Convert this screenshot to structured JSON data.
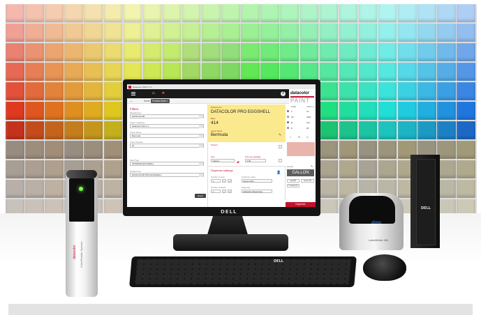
{
  "window": {
    "title": "Datacolor PAINT 1.0"
  },
  "app": {
    "logo_brand": "datacolor",
    "logo_product": "PAINT",
    "help_label": "?",
    "breadcrumb": {
      "home": "Home",
      "current_tab": "Formula Book",
      "tab_close": "×"
    }
  },
  "filters": {
    "title": "Filters",
    "items": [
      {
        "label": "Manufacturer",
        "value": "DATACOLOR"
      },
      {
        "label": "Colour Collection",
        "value": "Datacolor Demo 1"
      },
      {
        "label": "Colour Name",
        "value": "Bermuda"
      },
      {
        "label": "Colour Number",
        "value": "ID"
      },
      {
        "label": "Paint Type",
        "value": "INTERIOR EGGSHELL"
      },
      {
        "label": "Product Line",
        "value": "DATACOLOR PRO EGGSHELL"
      }
    ],
    "reset_label": "Reset"
  },
  "product": {
    "product_line_label": "Product Line",
    "product_line_value": "DATACOLOR PRO EGGSHELL",
    "base_label": "Base",
    "base_value": "414",
    "colour_name_label": "Colour Name",
    "colour_name_value": "Bermuda",
    "product_label": "Product",
    "size_label": "Size",
    "size_value": "Gallons",
    "price_label": "Price per package",
    "price_value": "0.00",
    "package_icon": "paint-can-icon"
  },
  "dispense": {
    "title": "Dispense settings",
    "number_of_cans_label": "Number of cans",
    "number_of_cans_value": "1",
    "customer_label": "Customer name",
    "customer_value": "james smith",
    "number_of_labels_label": "Number of labels",
    "number_of_labels_value": "1",
    "dispenser_label": "Dispenser",
    "dispenser_value": "datacolor [dispensing]"
  },
  "formula": {
    "col_name": "NAME",
    "col_amount": "1/384 fl oz",
    "rows": [
      {
        "name": "F",
        "amount": "76",
        "color": "#8a2a1e"
      },
      {
        "name": "KX",
        "amount": "4100",
        "color": "#ffffff"
      },
      {
        "name": "B",
        "amount": "124",
        "color": "#111111"
      },
      {
        "name": "D",
        "amount": "28",
        "color": "#f2b418"
      }
    ],
    "tool_icons": [
      "✓",
      "%",
      "⎙"
    ],
    "preview_color": "#e9b4ac"
  },
  "format": {
    "label": "Format",
    "selected": "GALLON",
    "options": [
      "QUART",
      "GALLON",
      "5 GALLON"
    ]
  },
  "actions": {
    "dispense_label": "Dispense"
  },
  "hardware": {
    "monitor_brand": "DELL",
    "keyboard_brand": "DELL",
    "pc_brand": "DELL",
    "printer_brand": "dimo",
    "printer_model": "LabelWriter 450",
    "spectro_brand": "datacolor",
    "spectro_model": "ColorReader Spectro"
  },
  "colors": {
    "accent": "#c8102e",
    "product_panel": "#fbe98d",
    "topbar": "#1a1a1a"
  }
}
